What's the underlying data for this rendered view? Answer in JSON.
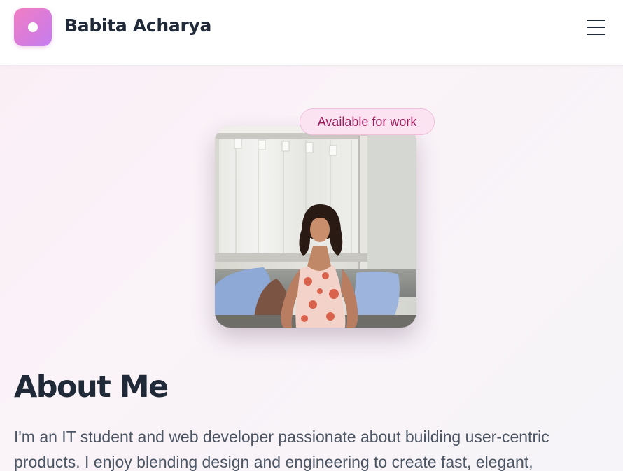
{
  "header": {
    "brand_name": "Babita Acharya",
    "logo_icon": "circle-dot-icon",
    "menu_icon": "hamburger-menu-icon"
  },
  "hero": {
    "badge_text": "Available for work",
    "profile_photo": "woman-seated-portrait-photo"
  },
  "about": {
    "title": "About Me",
    "text": "I'm an IT student and web developer passionate about building user-centric products. I enjoy blending design and engineering to create fast, elegant,"
  },
  "colors": {
    "accent_pink": "#f07dc3",
    "accent_purple": "#c57cf0",
    "badge_text": "#9d1d5c",
    "badge_bg": "#fbe3f1",
    "heading": "#1f2937",
    "body_text": "#4b5563"
  }
}
